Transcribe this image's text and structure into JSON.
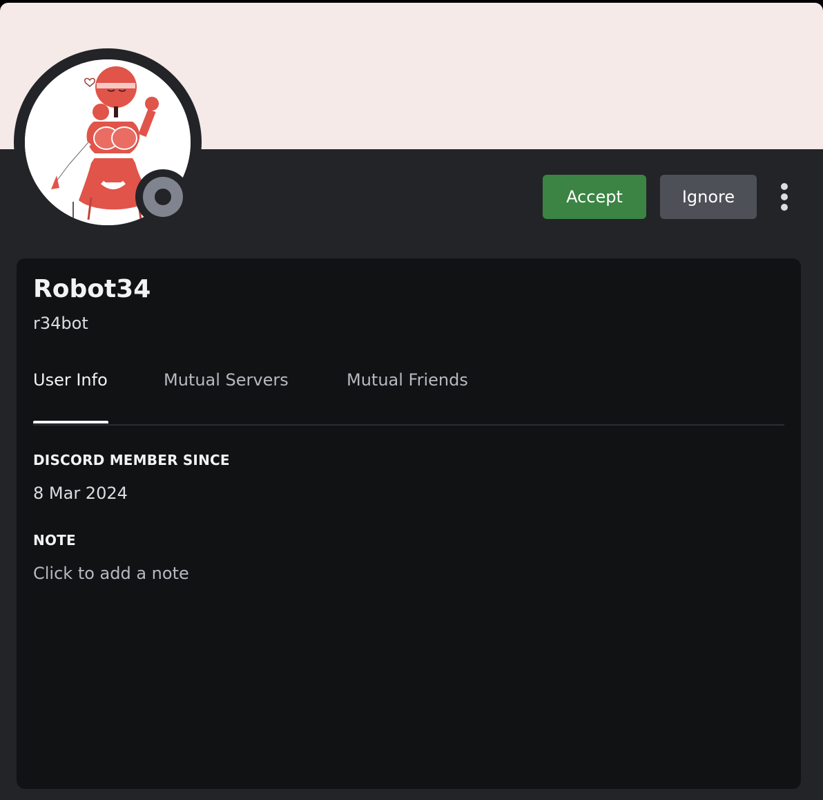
{
  "colors": {
    "banner": "#f5eae8",
    "accept": "#3b8444",
    "ignore": "#4e5058",
    "status_offline": "#80848e",
    "card_bg": "#111214",
    "modal_bg": "#232428"
  },
  "profile": {
    "display_name": "Robot34",
    "username": "r34bot",
    "status": "offline"
  },
  "actions": {
    "accept_label": "Accept",
    "ignore_label": "Ignore",
    "more_icon": "more-vertical-icon"
  },
  "tabs": [
    {
      "label": "User Info",
      "active": true
    },
    {
      "label": "Mutual Servers",
      "active": false
    },
    {
      "label": "Mutual Friends",
      "active": false
    }
  ],
  "user_info": {
    "member_since_heading": "DISCORD MEMBER SINCE",
    "member_since_value": "8 Mar 2024",
    "note_heading": "NOTE",
    "note_placeholder": "Click to add a note"
  }
}
